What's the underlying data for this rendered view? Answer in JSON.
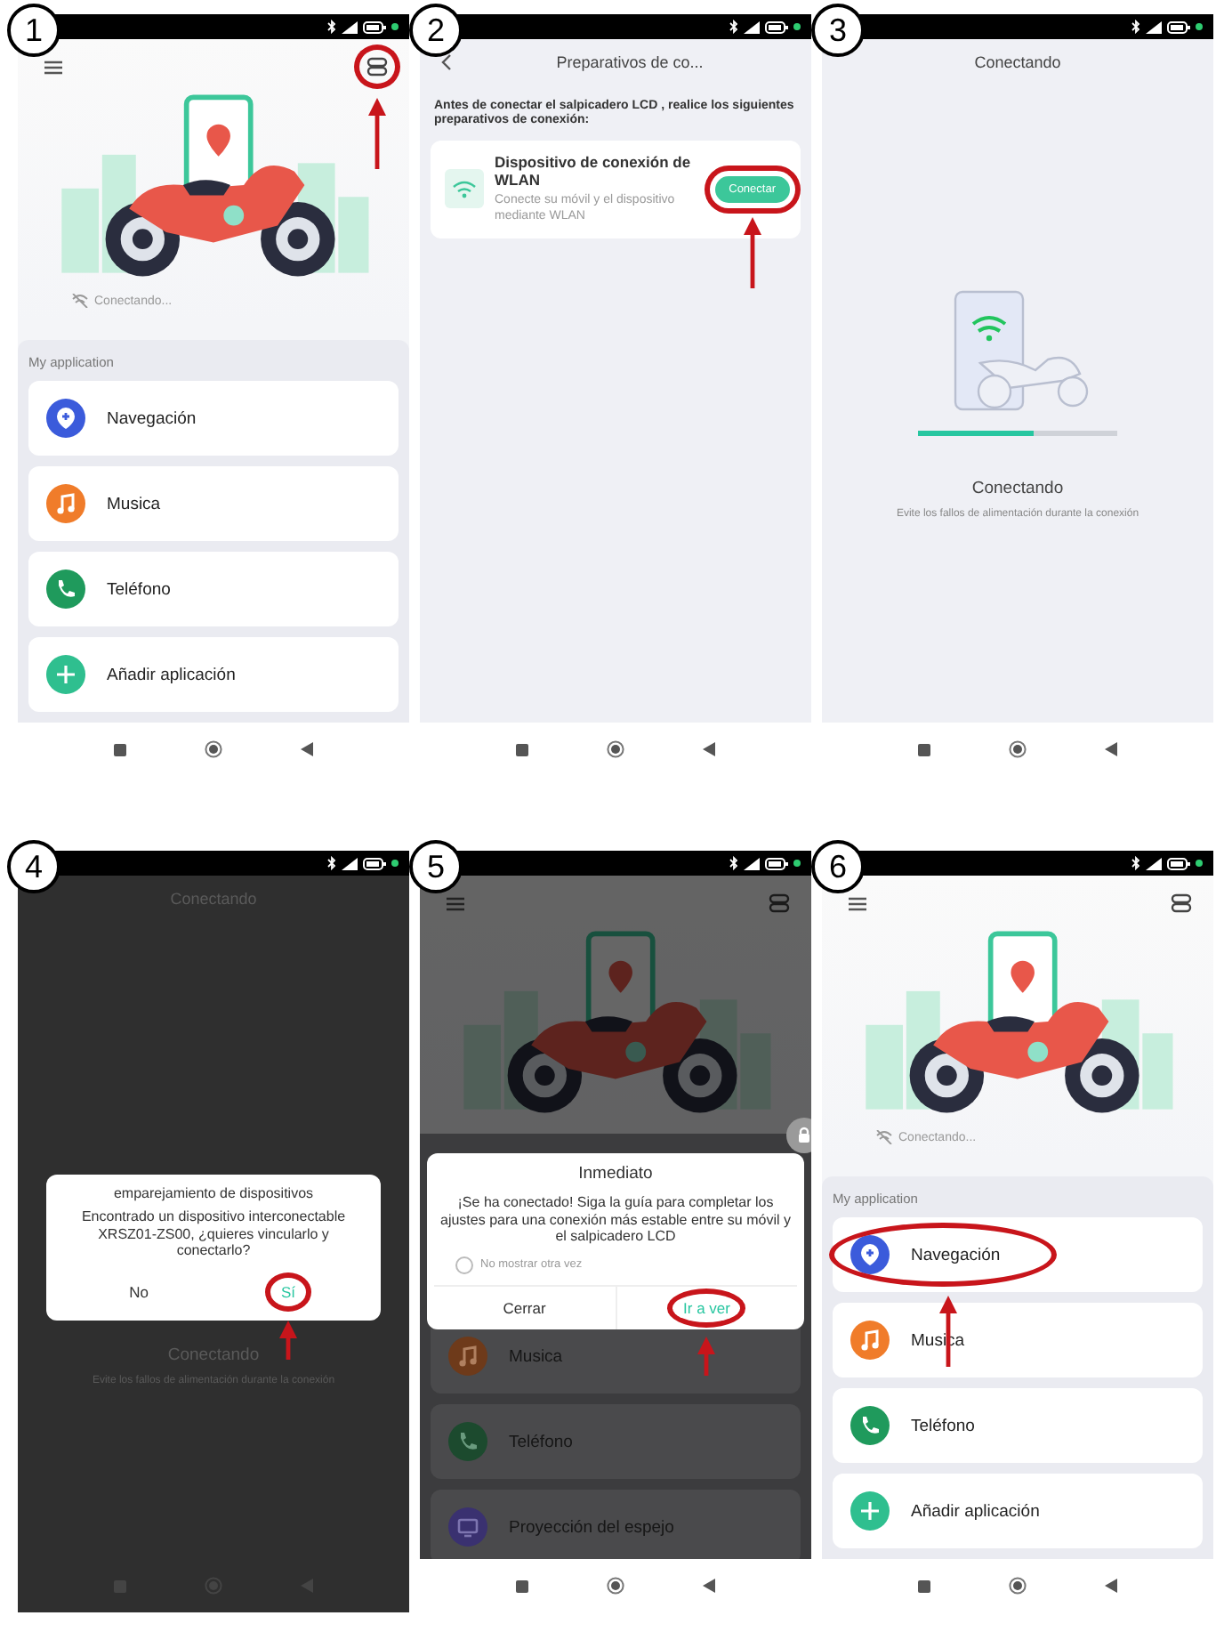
{
  "panels": [
    {
      "kind": "home",
      "step": "1",
      "menu_highlighted": true,
      "connection_status": "Conectando...",
      "section_title": "My application",
      "apps": [
        {
          "label": "Navegación",
          "kind": "navigation",
          "color": "#3b5bdb",
          "highlighted": false
        },
        {
          "label": "Musica",
          "kind": "music",
          "color": "#f07c2a",
          "highlighted": false
        },
        {
          "label": "Teléfono",
          "kind": "phone",
          "color": "#1f9a5c",
          "highlighted": false
        },
        {
          "label": "Añadir aplicación",
          "kind": "add",
          "color": "#2fbf8f",
          "highlighted": false
        }
      ]
    },
    {
      "kind": "prep",
      "step": "2",
      "title": "Preparativos de co...",
      "intro": "Antes de conectar el salpicadero LCD , realice los siguientes preparativos de conexión:",
      "card_title": "Dispositivo de conexión de WLAN",
      "card_text": "Conecte su móvil y el dispositivo mediante WLAN",
      "button": {
        "label": "Conectar",
        "highlighted": true
      }
    },
    {
      "kind": "connecting",
      "step": "3",
      "title": "Conectando",
      "status": "Conectando",
      "hint": "Evite los fallos de alimentación durante la conexión",
      "level": 0.58
    },
    {
      "kind": "pairing",
      "step": "4",
      "title": "Conectando",
      "status": "Conectando",
      "hint": "Evite los fallos de alimentación durante la conexión",
      "dialog": {
        "title": "emparejamiento de dispositivos",
        "message": "Encontrado un dispositivo interconectable XRSZ01-ZS00, ¿quieres vincularlo y conectarlo?",
        "buttons": [
          {
            "label": "No",
            "primary": false,
            "highlighted": false
          },
          {
            "label": "Sí",
            "primary": true,
            "highlighted": true
          }
        ]
      }
    },
    {
      "kind": "guide",
      "step": "5",
      "menu_highlighted": false,
      "apps": [
        {
          "label": "Musica",
          "kind": "music",
          "color": "#6e3a1a",
          "highlighted": false
        },
        {
          "label": "Teléfono",
          "kind": "phone",
          "color": "#1c4a2e",
          "highlighted": false
        },
        {
          "label": "Proyección del espejo",
          "kind": "mirror",
          "color": "#3a3170",
          "highlighted": false
        }
      ],
      "dialog": {
        "title": "Inmediato",
        "message": "¡Se ha conectado! Siga la guía para completar los ajustes para una conexión más estable entre su móvil y el salpicadero LCD",
        "checkbox": {
          "label": "No mostrar otra vez",
          "checked": false
        },
        "buttons": [
          {
            "label": "Cerrar",
            "primary": false,
            "highlighted": false
          },
          {
            "label": "Ir a ver",
            "primary": true,
            "highlighted": true
          }
        ]
      }
    },
    {
      "kind": "home",
      "step": "6",
      "menu_highlighted": false,
      "connection_status": "Conectando...",
      "section_title": "My application",
      "apps": [
        {
          "label": "Navegación",
          "kind": "navigation",
          "color": "#3b5bdb",
          "highlighted": true
        },
        {
          "label": "Musica",
          "kind": "music",
          "color": "#f07c2a",
          "highlighted": false
        },
        {
          "label": "Teléfono",
          "kind": "phone",
          "color": "#1f9a5c",
          "highlighted": false
        },
        {
          "label": "Añadir aplicación",
          "kind": "add",
          "color": "#2fbf8f",
          "highlighted": false
        }
      ]
    }
  ]
}
